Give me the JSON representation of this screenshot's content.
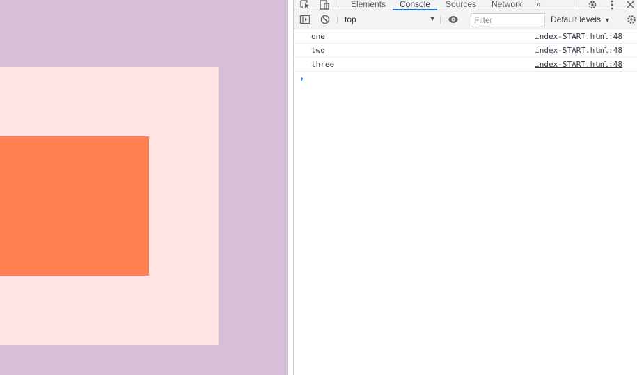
{
  "page": {
    "colors": {
      "background": "#d8bfd8",
      "outer_box": "#ffe4e1",
      "inner_box": "#ff7f50"
    }
  },
  "devtools": {
    "tabs": [
      {
        "label": "Elements",
        "active": false
      },
      {
        "label": "Console",
        "active": true
      },
      {
        "label": "Sources",
        "active": false
      },
      {
        "label": "Network",
        "active": false
      }
    ],
    "overflow_glyph": "»",
    "toolbar": {
      "context": "top",
      "filter_placeholder": "Filter",
      "levels_label": "Default levels"
    },
    "console": {
      "messages": [
        {
          "text": "one",
          "source": "index-START.html:48"
        },
        {
          "text": "two",
          "source": "index-START.html:48"
        },
        {
          "text": "three",
          "source": "index-START.html:48"
        }
      ],
      "prompt_glyph": "›"
    },
    "accent_color": "#1a73e8"
  }
}
